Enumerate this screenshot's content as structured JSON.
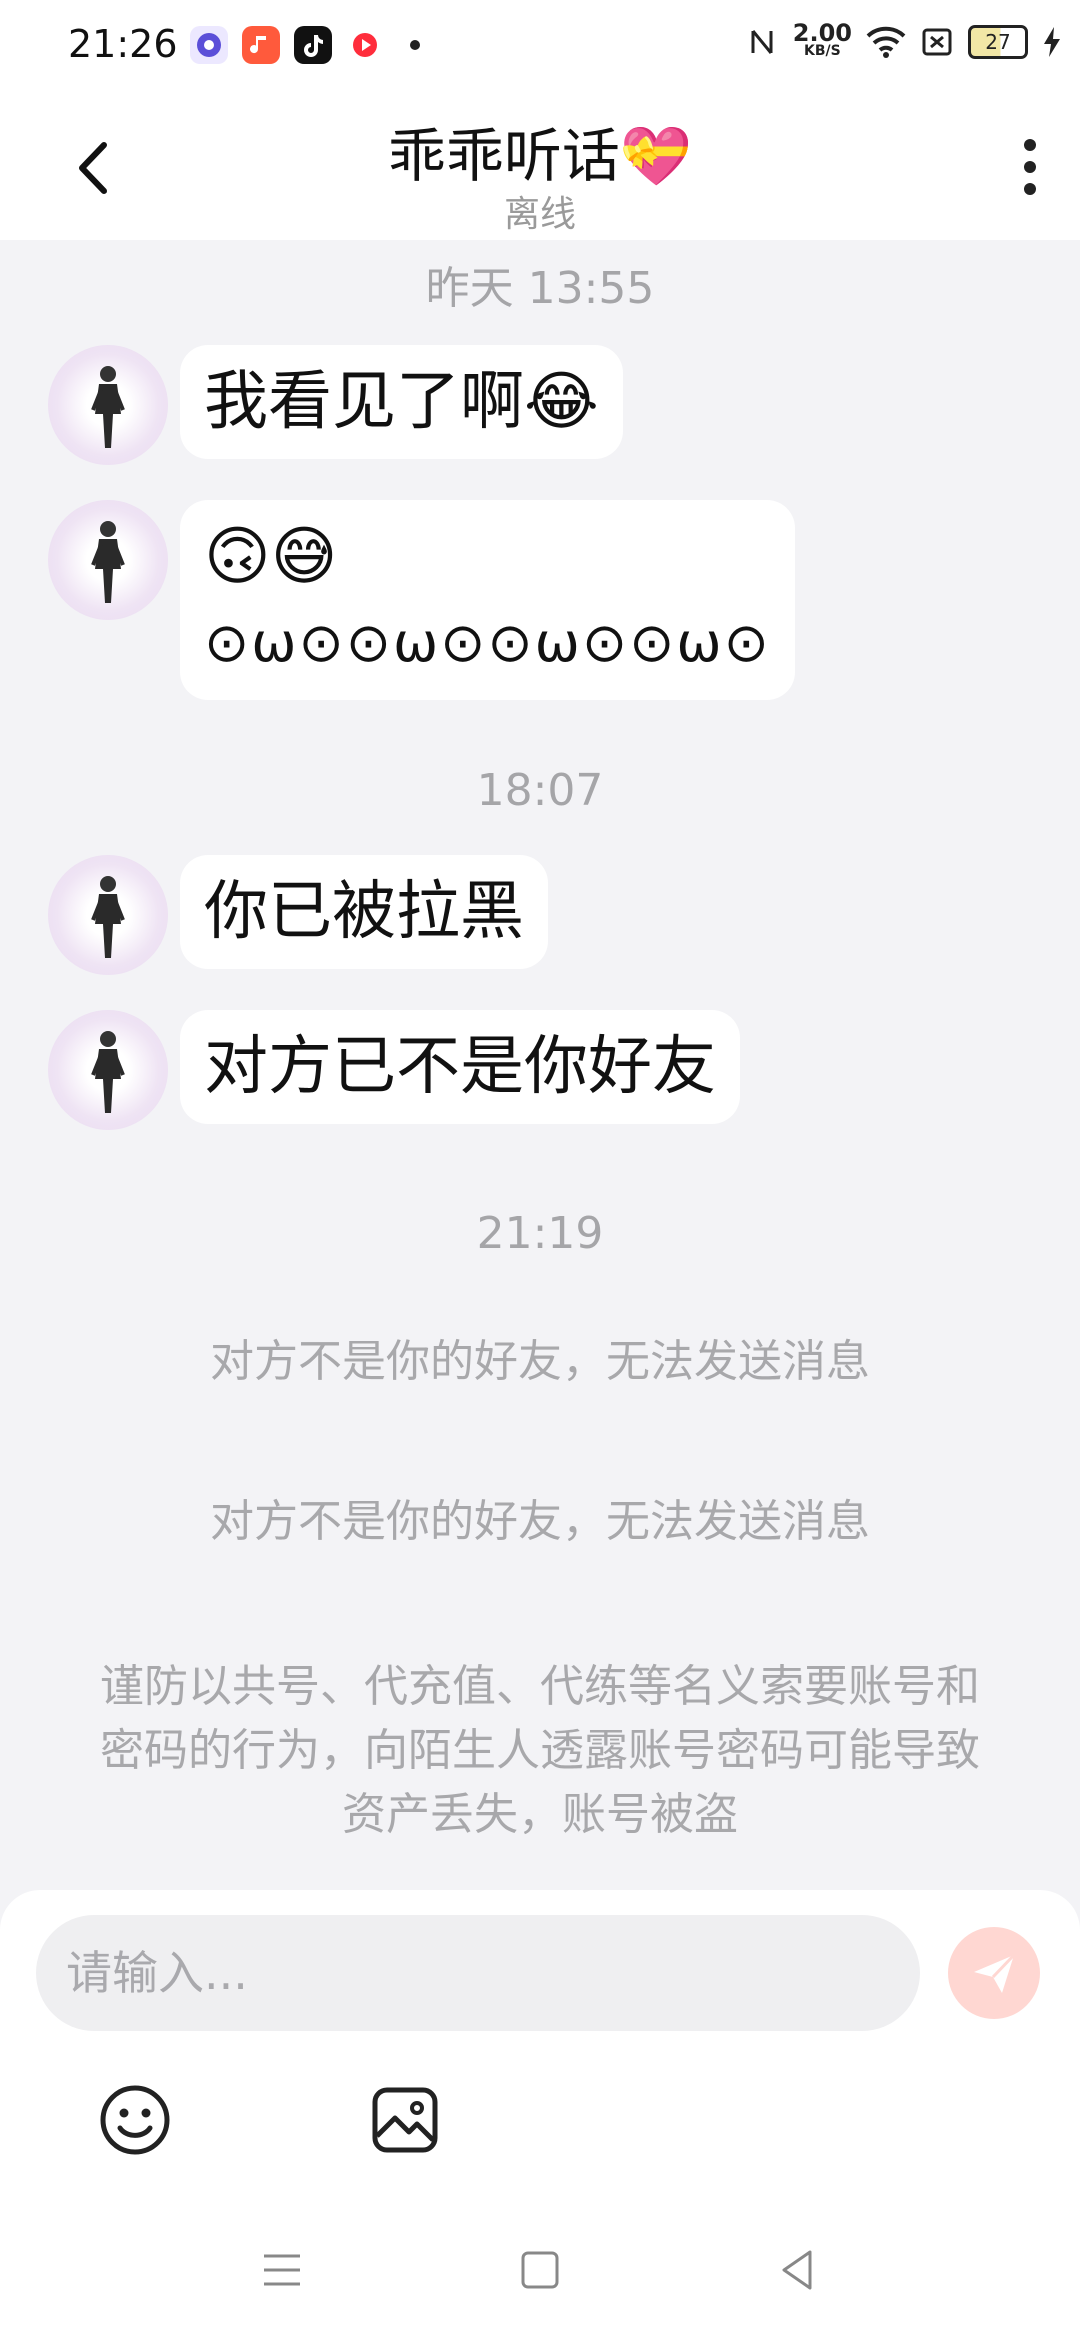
{
  "status_bar": {
    "time": "21:26",
    "network_speed_value": "2.00",
    "network_speed_unit": "KB/S",
    "battery": "27",
    "app_icons": [
      "browser-icon",
      "music-app-icon",
      "tiktok-icon",
      "video-app-icon"
    ]
  },
  "header": {
    "title": "乖乖听话💝",
    "subtitle": "离线"
  },
  "chat": {
    "timestamps": [
      "昨天 13:55",
      "18:07",
      "21:19"
    ],
    "messages": [
      {
        "text": "我看见了啊😂"
      },
      {
        "line1": "🙃😅",
        "line2": "⊙ω⊙⊙ω⊙⊙ω⊙⊙ω⊙"
      },
      {
        "text": "你已被拉黑"
      },
      {
        "text": "对方已不是你好友"
      }
    ],
    "system_notices": [
      "对方不是你的好友，无法发送消息",
      "对方不是你的好友，无法发送消息"
    ],
    "warning": "谨防以共号、代充值、代练等名义索要账号和密码的行为，向陌生人透露账号密码可能导致资产丢失，账号被盗"
  },
  "input_bar": {
    "placeholder": "请输入..."
  },
  "colors": {
    "background": "#f3f3f6",
    "bubble": "#ffffff",
    "send_button": "#ffd7d2",
    "muted_text": "#a8a8ab"
  }
}
